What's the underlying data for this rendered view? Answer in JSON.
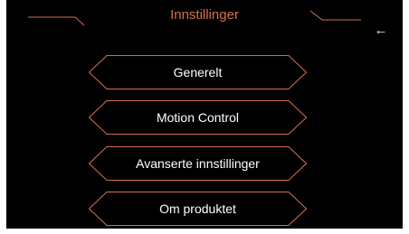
{
  "header": {
    "title": "Innstillinger",
    "back_icon": "arrow-left-icon",
    "back_glyph": "←"
  },
  "menu": {
    "items": [
      {
        "label": "Generelt"
      },
      {
        "label": "Motion Control"
      },
      {
        "label": "Avanserte innstillinger"
      },
      {
        "label": "Om produktet"
      }
    ]
  },
  "colors": {
    "background": "#000000",
    "accent": "#d4714a",
    "text": "#ffffff"
  }
}
